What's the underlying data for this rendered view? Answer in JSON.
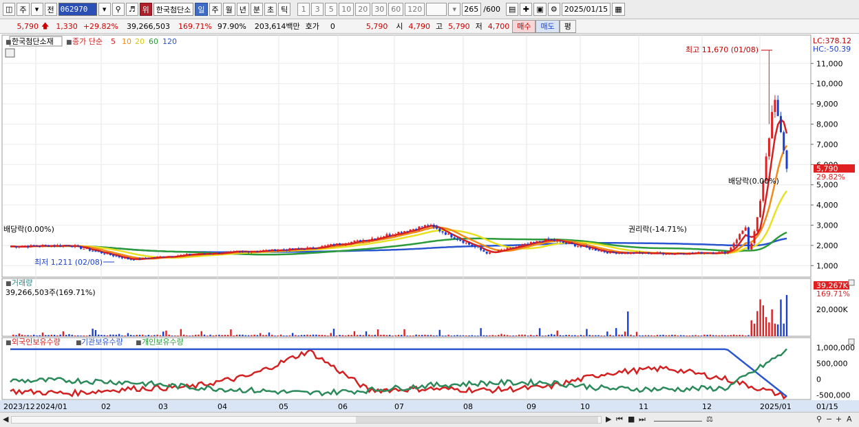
{
  "toolbar": {
    "type_label": "주",
    "jeon_label": "전",
    "code": "062970",
    "warn_badge": "위",
    "stock_name": "한국첨단소",
    "period_tabs": [
      "일",
      "주",
      "월",
      "년",
      "분",
      "초",
      "틱"
    ],
    "active_period": "일",
    "minute_presets": [
      "1",
      "3",
      "5",
      "10",
      "20",
      "30",
      "60",
      "120"
    ],
    "count": "265",
    "count_total": "/600",
    "date": "2025/01/15"
  },
  "quote": {
    "price": "5,790",
    "change": "1,330",
    "change_pct": "+29.82%",
    "volume": "39,266,503",
    "volume_ratio": "169.71%",
    "ratio2": "97.90%",
    "amount": "203,614백만",
    "hoga_label": "호가",
    "hoga_value": "0",
    "hoga_price": "5,790",
    "open_label": "시",
    "open": "4,790",
    "high_label": "고",
    "high": "5,790",
    "low_label": "저",
    "low": "4,700",
    "buy_label": "매수",
    "sell_label": "매도",
    "eval_label": "평"
  },
  "legend": {
    "stock_name": "한국첨단소재",
    "ma_label": "종가 단순",
    "ma_periods": [
      "5",
      "10",
      "20",
      "60",
      "120"
    ],
    "ma_colors": [
      "#d42020",
      "#f08a18",
      "#e8e020",
      "#2a9a3a",
      "#2a55d0"
    ]
  },
  "annotations": {
    "high_label": "최고 11,670 (01/08)",
    "low_label": "최저 1,211 (02/08)",
    "dividend_left": "배당락(0.00%)",
    "dividend_right": "배당락(0.00%)",
    "rights_label": "권리락(-14.71%)",
    "lc": "LC:378.12",
    "hc": "HC:-50.39",
    "price_tag": "5,790",
    "pct_tag": "29.82%"
  },
  "volume_panel": {
    "title": "거래량",
    "current": "39,266,503주(169.71%)",
    "tag_value": "39,267K",
    "tag_pct": "169.71%",
    "axis_label": "20,000K"
  },
  "holdings_panel": {
    "series_names": [
      "외국인보유수량",
      "기관보유수량",
      "개인보유수량"
    ],
    "axis_labels": [
      "1,000,000",
      "500,000",
      "0",
      "-500,000"
    ]
  },
  "x_axis": {
    "labels": [
      "2023/12",
      "2024/01",
      "02",
      "03",
      "04",
      "05",
      "06",
      "07",
      "08",
      "09",
      "10",
      "11",
      "12",
      "2025/01",
      "01/15"
    ]
  },
  "chart_data": {
    "type": "candlestick",
    "price_axis": [
      1000,
      2000,
      3000,
      4000,
      5000,
      6000,
      7000,
      8000,
      9000,
      10000,
      11000
    ],
    "price_ylim": [
      500,
      12200
    ],
    "months": [
      "2023/12",
      "2024/01",
      "02",
      "03",
      "04",
      "05",
      "06",
      "07",
      "08",
      "09",
      "10",
      "11",
      "12",
      "2025/01"
    ],
    "close_trend": [
      1950,
      2000,
      1300,
      1550,
      1700,
      1850,
      2300,
      3000,
      1600,
      2300,
      1650,
      1600,
      1650,
      5790
    ],
    "last_close": 5790,
    "high": 11670,
    "high_date": "01/08",
    "low": 1211,
    "low_date": "02/08",
    "ma_last": {
      "ma5": 6500,
      "ma10": 7000,
      "ma20": 5000,
      "ma60": 2800,
      "ma120": 2400
    },
    "last_volume": 39266503,
    "volume_axis": [
      20000000
    ],
    "holdings_ylim": [
      -600000,
      1100000
    ],
    "holdings_trend": {
      "외국인보유수량": [
        -380000,
        -450000,
        -300000,
        -250000,
        100000,
        900000,
        -350000,
        -300000,
        -350000,
        -250000,
        200000,
        350000,
        0,
        -550000
      ],
      "기관보유수량": [
        950000,
        950000,
        950000,
        950000,
        950000,
        950000,
        950000,
        950000,
        950000,
        950000,
        950000,
        950000,
        950000,
        -550000
      ],
      "개인보유수량": [
        -50000,
        -40000,
        -100000,
        -250000,
        -350000,
        -450000,
        -350000,
        -200000,
        -120000,
        -100000,
        -300000,
        -320000,
        -280000,
        900000
      ]
    }
  }
}
